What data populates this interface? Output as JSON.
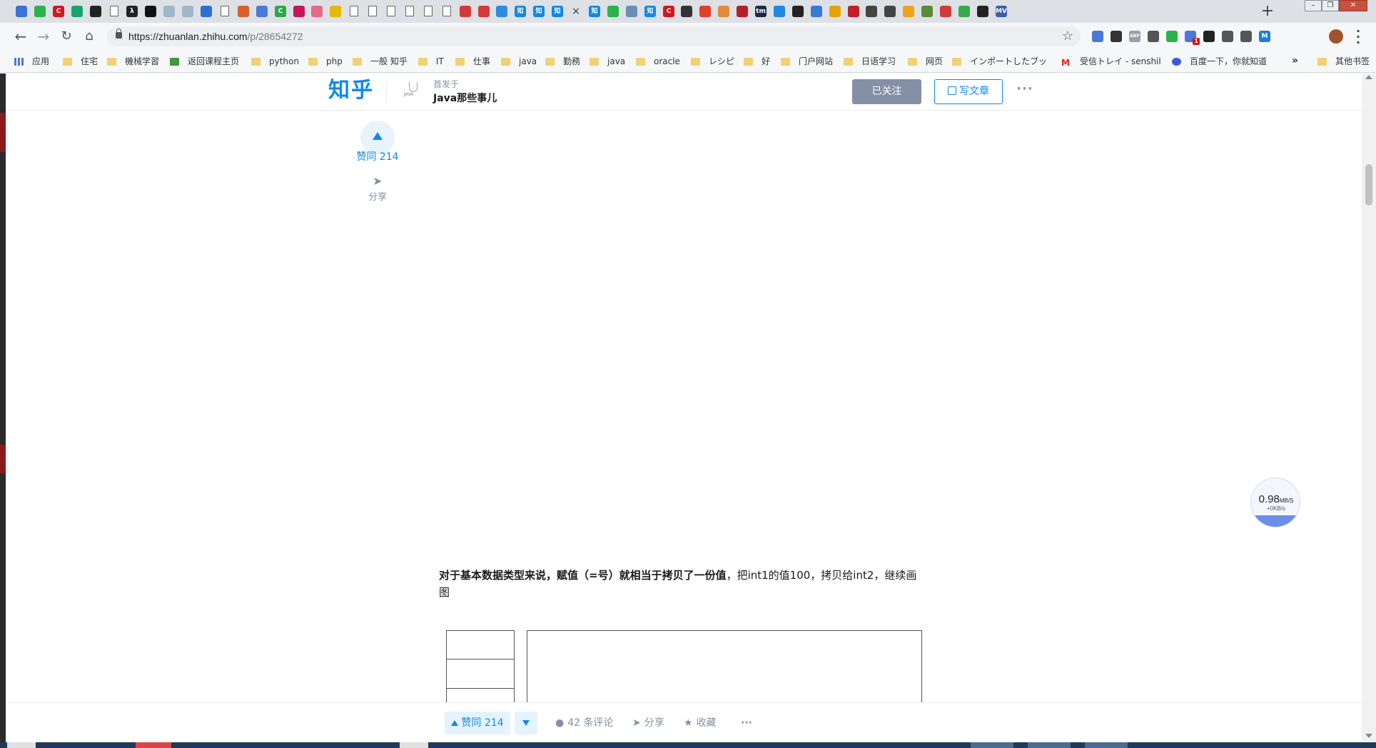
{
  "browser": {
    "tab_favicons": [
      {
        "name": "tab-favicon-1",
        "glyph": "",
        "color": "#3b73d6"
      },
      {
        "name": "tab-favicon-2",
        "glyph": "",
        "color": "#2bb24c"
      },
      {
        "name": "tab-favicon-3",
        "glyph": "C",
        "color": "#d0181f"
      },
      {
        "name": "tab-favicon-4",
        "glyph": "",
        "color": "#1aa36b"
      },
      {
        "name": "tab-favicon-5",
        "glyph": "",
        "color": "#222222"
      },
      {
        "name": "tab-favicon-6",
        "glyph": "",
        "color": "page"
      },
      {
        "name": "tab-favicon-7",
        "glyph": "λ",
        "color": "#222222"
      },
      {
        "name": "tab-favicon-8",
        "glyph": "",
        "color": "#111111"
      },
      {
        "name": "tab-favicon-9",
        "glyph": "",
        "color": "#9fb7c9"
      },
      {
        "name": "tab-favicon-10",
        "glyph": "",
        "color": "#9fb7c9"
      },
      {
        "name": "tab-favicon-11",
        "glyph": "",
        "color": "#2e6fd1"
      },
      {
        "name": "tab-favicon-12",
        "glyph": "",
        "color": "page"
      },
      {
        "name": "tab-favicon-13",
        "glyph": "",
        "color": "#d9602a"
      },
      {
        "name": "tab-favicon-14",
        "glyph": "",
        "color": "#4a7bd8"
      },
      {
        "name": "tab-favicon-15",
        "glyph": "C",
        "color": "#2aa84a"
      },
      {
        "name": "tab-favicon-16",
        "glyph": "",
        "color": "#c2185b"
      },
      {
        "name": "tab-favicon-17",
        "glyph": "",
        "color": "#e56a8a"
      },
      {
        "name": "tab-favicon-18",
        "glyph": "",
        "color": "#e6b800"
      },
      {
        "name": "tab-favicon-19",
        "glyph": "",
        "color": "page"
      },
      {
        "name": "tab-favicon-20",
        "glyph": "",
        "color": "page"
      },
      {
        "name": "tab-favicon-21",
        "glyph": "",
        "color": "page"
      },
      {
        "name": "tab-favicon-22",
        "glyph": "",
        "color": "page"
      },
      {
        "name": "tab-favicon-23",
        "glyph": "",
        "color": "page"
      },
      {
        "name": "tab-favicon-24",
        "glyph": "",
        "color": "page"
      },
      {
        "name": "tab-favicon-25",
        "glyph": "",
        "color": "#d23a3a"
      },
      {
        "name": "tab-favicon-26",
        "glyph": "",
        "color": "#d23a3a"
      },
      {
        "name": "tab-favicon-27",
        "glyph": "",
        "color": "#2e8be0"
      },
      {
        "name": "tab-favicon-28",
        "glyph": "知",
        "color": "#0f88eb"
      },
      {
        "name": "tab-favicon-29",
        "glyph": "知",
        "color": "#0f88eb"
      },
      {
        "name": "tab-favicon-30",
        "glyph": "知",
        "color": "#0f88eb"
      },
      {
        "name": "tab-favicon-31",
        "glyph": "×",
        "color": "close"
      },
      {
        "name": "tab-favicon-32",
        "glyph": "知",
        "color": "#0f88eb"
      },
      {
        "name": "tab-favicon-33",
        "glyph": "",
        "color": "#2bb24c"
      },
      {
        "name": "tab-favicon-34",
        "glyph": "",
        "color": "#6a8fb5"
      },
      {
        "name": "tab-favicon-35",
        "glyph": "知",
        "color": "#0f88eb"
      },
      {
        "name": "tab-favicon-36",
        "glyph": "C",
        "color": "#d0181f"
      },
      {
        "name": "tab-favicon-37",
        "glyph": "",
        "color": "#333333"
      },
      {
        "name": "tab-favicon-38",
        "glyph": "",
        "color": "#e0402a"
      },
      {
        "name": "tab-favicon-39",
        "glyph": "",
        "color": "#e08a3a"
      },
      {
        "name": "tab-favicon-40",
        "glyph": "",
        "color": "#b3202a"
      },
      {
        "name": "tab-favicon-41",
        "glyph": "tm",
        "color": "#1c2a4a"
      },
      {
        "name": "tab-favicon-42",
        "glyph": "",
        "color": "#1e88e5"
      },
      {
        "name": "tab-favicon-43",
        "glyph": "",
        "color": "#222222"
      },
      {
        "name": "tab-favicon-44",
        "glyph": "",
        "color": "#3a78d6"
      },
      {
        "name": "tab-favicon-45",
        "glyph": "",
        "color": "#e6a400"
      },
      {
        "name": "tab-favicon-46",
        "glyph": "",
        "color": "#c0202a"
      },
      {
        "name": "tab-favicon-47",
        "glyph": "",
        "color": "#444444"
      },
      {
        "name": "tab-favicon-48",
        "glyph": "",
        "color": "#444444"
      },
      {
        "name": "tab-favicon-49",
        "glyph": "",
        "color": "#f2a31a"
      },
      {
        "name": "tab-favicon-50",
        "glyph": "",
        "color": "#5a8a3a"
      },
      {
        "name": "tab-favicon-51",
        "glyph": "",
        "color": "#d23a3a"
      },
      {
        "name": "tab-favicon-52",
        "glyph": "",
        "color": "#3aa84a"
      },
      {
        "name": "tab-favicon-53",
        "glyph": "",
        "color": "#222222"
      },
      {
        "name": "tab-favicon-54",
        "glyph": "MVN",
        "color": "#3a5ea8"
      }
    ],
    "new_tab_label": "+",
    "window_controls": {
      "minimize": "–",
      "restore": "❐",
      "close": "✕"
    },
    "url": {
      "prefix": "https://zhuanlan.zhihu.com",
      "path": "/p/28654272"
    },
    "star_glyph": "☆",
    "extensions": [
      {
        "name": "translate-ext-icon",
        "color": "#4a78d8"
      },
      {
        "name": "ext-icon-2",
        "color": "#333333"
      },
      {
        "name": "adblock-plus-ext-icon",
        "color": "#9aa0a6",
        "glyph": "ABP"
      },
      {
        "name": "ext-icon-4",
        "color": "#555555"
      },
      {
        "name": "evernote-ext-icon",
        "color": "#2bb24c"
      },
      {
        "name": "ext-icon-6",
        "color": "#4a78d8",
        "badge": "1"
      },
      {
        "name": "search-ext-icon",
        "color": "#222222"
      },
      {
        "name": "ext-icon-8",
        "color": "#555555"
      },
      {
        "name": "pocket-ext-icon",
        "color": "#555555"
      },
      {
        "name": "ext-icon-10",
        "color": "#1c7fd6",
        "glyph": "M"
      }
    ],
    "bookmarks": [
      {
        "label": "应用",
        "icon": "apps"
      },
      {
        "label": "住宅",
        "icon": "folder"
      },
      {
        "label": "機械学習",
        "icon": "folder"
      },
      {
        "label": "返回课程主页",
        "icon": "green"
      },
      {
        "label": "python",
        "icon": "folder"
      },
      {
        "label": "php",
        "icon": "folder"
      },
      {
        "label": "一般 知乎",
        "icon": "folder"
      },
      {
        "label": "IT",
        "icon": "folder"
      },
      {
        "label": "仕事",
        "icon": "folder"
      },
      {
        "label": "java",
        "icon": "folder"
      },
      {
        "label": "勤務",
        "icon": "folder"
      },
      {
        "label": "java",
        "icon": "folder"
      },
      {
        "label": "oracle",
        "icon": "folder"
      },
      {
        "label": "レシピ",
        "icon": "folder"
      },
      {
        "label": "好",
        "icon": "folder"
      },
      {
        "label": "门户网站",
        "icon": "folder"
      },
      {
        "label": "日语学习",
        "icon": "folder"
      },
      {
        "label": "网页",
        "icon": "folder"
      },
      {
        "label": "インポートしたブッ",
        "icon": "folder"
      },
      {
        "label": "受信トレイ - senshil",
        "icon": "gmail"
      },
      {
        "label": "百度一下，你就知道",
        "icon": "baidu"
      }
    ],
    "bookmarks_more": "»",
    "other_bookmarks": "其他书签"
  },
  "page": {
    "logo": "知乎",
    "column": {
      "avatar_text": "JAVA",
      "published_in": "首发于",
      "name": "Java那些事儿"
    },
    "header_buttons": {
      "followed": "已关注",
      "write": "写文章",
      "more": "···"
    },
    "side": {
      "vote_label": "赞同 214",
      "share_label": "分享",
      "share_glyph": "➤"
    },
    "article": {
      "bold_text": "对于基本数据类型来说，赋值（=号）就相当于拷贝了一份值",
      "normal_text": "，把int1的值100，拷贝给int2，继续画图"
    },
    "speed_widget": {
      "value": "0.98",
      "unit": "MB/S",
      "sub": "+0KB/s"
    },
    "action_bar": {
      "vote": "赞同 214",
      "comments": "42 条评论",
      "share": "分享",
      "collect": "收藏",
      "more": "···"
    }
  }
}
